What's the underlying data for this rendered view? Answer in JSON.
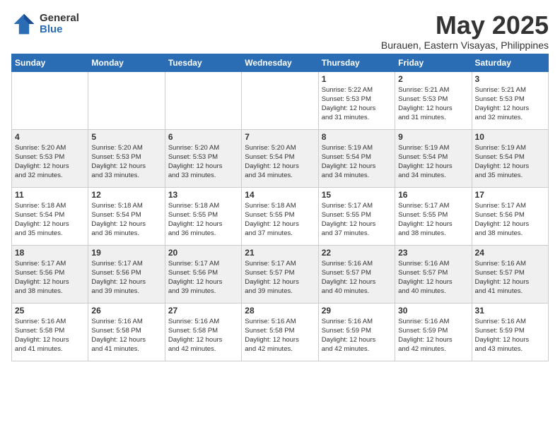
{
  "logo": {
    "general": "General",
    "blue": "Blue"
  },
  "title": "May 2025",
  "location": "Burauen, Eastern Visayas, Philippines",
  "days": [
    "Sunday",
    "Monday",
    "Tuesday",
    "Wednesday",
    "Thursday",
    "Friday",
    "Saturday"
  ],
  "weeks": [
    [
      {
        "day": "",
        "info": ""
      },
      {
        "day": "",
        "info": ""
      },
      {
        "day": "",
        "info": ""
      },
      {
        "day": "",
        "info": ""
      },
      {
        "day": "1",
        "info": "Sunrise: 5:22 AM\nSunset: 5:53 PM\nDaylight: 12 hours\nand 31 minutes."
      },
      {
        "day": "2",
        "info": "Sunrise: 5:21 AM\nSunset: 5:53 PM\nDaylight: 12 hours\nand 31 minutes."
      },
      {
        "day": "3",
        "info": "Sunrise: 5:21 AM\nSunset: 5:53 PM\nDaylight: 12 hours\nand 32 minutes."
      }
    ],
    [
      {
        "day": "4",
        "info": "Sunrise: 5:20 AM\nSunset: 5:53 PM\nDaylight: 12 hours\nand 32 minutes."
      },
      {
        "day": "5",
        "info": "Sunrise: 5:20 AM\nSunset: 5:53 PM\nDaylight: 12 hours\nand 33 minutes."
      },
      {
        "day": "6",
        "info": "Sunrise: 5:20 AM\nSunset: 5:53 PM\nDaylight: 12 hours\nand 33 minutes."
      },
      {
        "day": "7",
        "info": "Sunrise: 5:20 AM\nSunset: 5:54 PM\nDaylight: 12 hours\nand 34 minutes."
      },
      {
        "day": "8",
        "info": "Sunrise: 5:19 AM\nSunset: 5:54 PM\nDaylight: 12 hours\nand 34 minutes."
      },
      {
        "day": "9",
        "info": "Sunrise: 5:19 AM\nSunset: 5:54 PM\nDaylight: 12 hours\nand 34 minutes."
      },
      {
        "day": "10",
        "info": "Sunrise: 5:19 AM\nSunset: 5:54 PM\nDaylight: 12 hours\nand 35 minutes."
      }
    ],
    [
      {
        "day": "11",
        "info": "Sunrise: 5:18 AM\nSunset: 5:54 PM\nDaylight: 12 hours\nand 35 minutes."
      },
      {
        "day": "12",
        "info": "Sunrise: 5:18 AM\nSunset: 5:54 PM\nDaylight: 12 hours\nand 36 minutes."
      },
      {
        "day": "13",
        "info": "Sunrise: 5:18 AM\nSunset: 5:55 PM\nDaylight: 12 hours\nand 36 minutes."
      },
      {
        "day": "14",
        "info": "Sunrise: 5:18 AM\nSunset: 5:55 PM\nDaylight: 12 hours\nand 37 minutes."
      },
      {
        "day": "15",
        "info": "Sunrise: 5:17 AM\nSunset: 5:55 PM\nDaylight: 12 hours\nand 37 minutes."
      },
      {
        "day": "16",
        "info": "Sunrise: 5:17 AM\nSunset: 5:55 PM\nDaylight: 12 hours\nand 38 minutes."
      },
      {
        "day": "17",
        "info": "Sunrise: 5:17 AM\nSunset: 5:56 PM\nDaylight: 12 hours\nand 38 minutes."
      }
    ],
    [
      {
        "day": "18",
        "info": "Sunrise: 5:17 AM\nSunset: 5:56 PM\nDaylight: 12 hours\nand 38 minutes."
      },
      {
        "day": "19",
        "info": "Sunrise: 5:17 AM\nSunset: 5:56 PM\nDaylight: 12 hours\nand 39 minutes."
      },
      {
        "day": "20",
        "info": "Sunrise: 5:17 AM\nSunset: 5:56 PM\nDaylight: 12 hours\nand 39 minutes."
      },
      {
        "day": "21",
        "info": "Sunrise: 5:17 AM\nSunset: 5:57 PM\nDaylight: 12 hours\nand 39 minutes."
      },
      {
        "day": "22",
        "info": "Sunrise: 5:16 AM\nSunset: 5:57 PM\nDaylight: 12 hours\nand 40 minutes."
      },
      {
        "day": "23",
        "info": "Sunrise: 5:16 AM\nSunset: 5:57 PM\nDaylight: 12 hours\nand 40 minutes."
      },
      {
        "day": "24",
        "info": "Sunrise: 5:16 AM\nSunset: 5:57 PM\nDaylight: 12 hours\nand 41 minutes."
      }
    ],
    [
      {
        "day": "25",
        "info": "Sunrise: 5:16 AM\nSunset: 5:58 PM\nDaylight: 12 hours\nand 41 minutes."
      },
      {
        "day": "26",
        "info": "Sunrise: 5:16 AM\nSunset: 5:58 PM\nDaylight: 12 hours\nand 41 minutes."
      },
      {
        "day": "27",
        "info": "Sunrise: 5:16 AM\nSunset: 5:58 PM\nDaylight: 12 hours\nand 42 minutes."
      },
      {
        "day": "28",
        "info": "Sunrise: 5:16 AM\nSunset: 5:58 PM\nDaylight: 12 hours\nand 42 minutes."
      },
      {
        "day": "29",
        "info": "Sunrise: 5:16 AM\nSunset: 5:59 PM\nDaylight: 12 hours\nand 42 minutes."
      },
      {
        "day": "30",
        "info": "Sunrise: 5:16 AM\nSunset: 5:59 PM\nDaylight: 12 hours\nand 42 minutes."
      },
      {
        "day": "31",
        "info": "Sunrise: 5:16 AM\nSunset: 5:59 PM\nDaylight: 12 hours\nand 43 minutes."
      }
    ]
  ]
}
